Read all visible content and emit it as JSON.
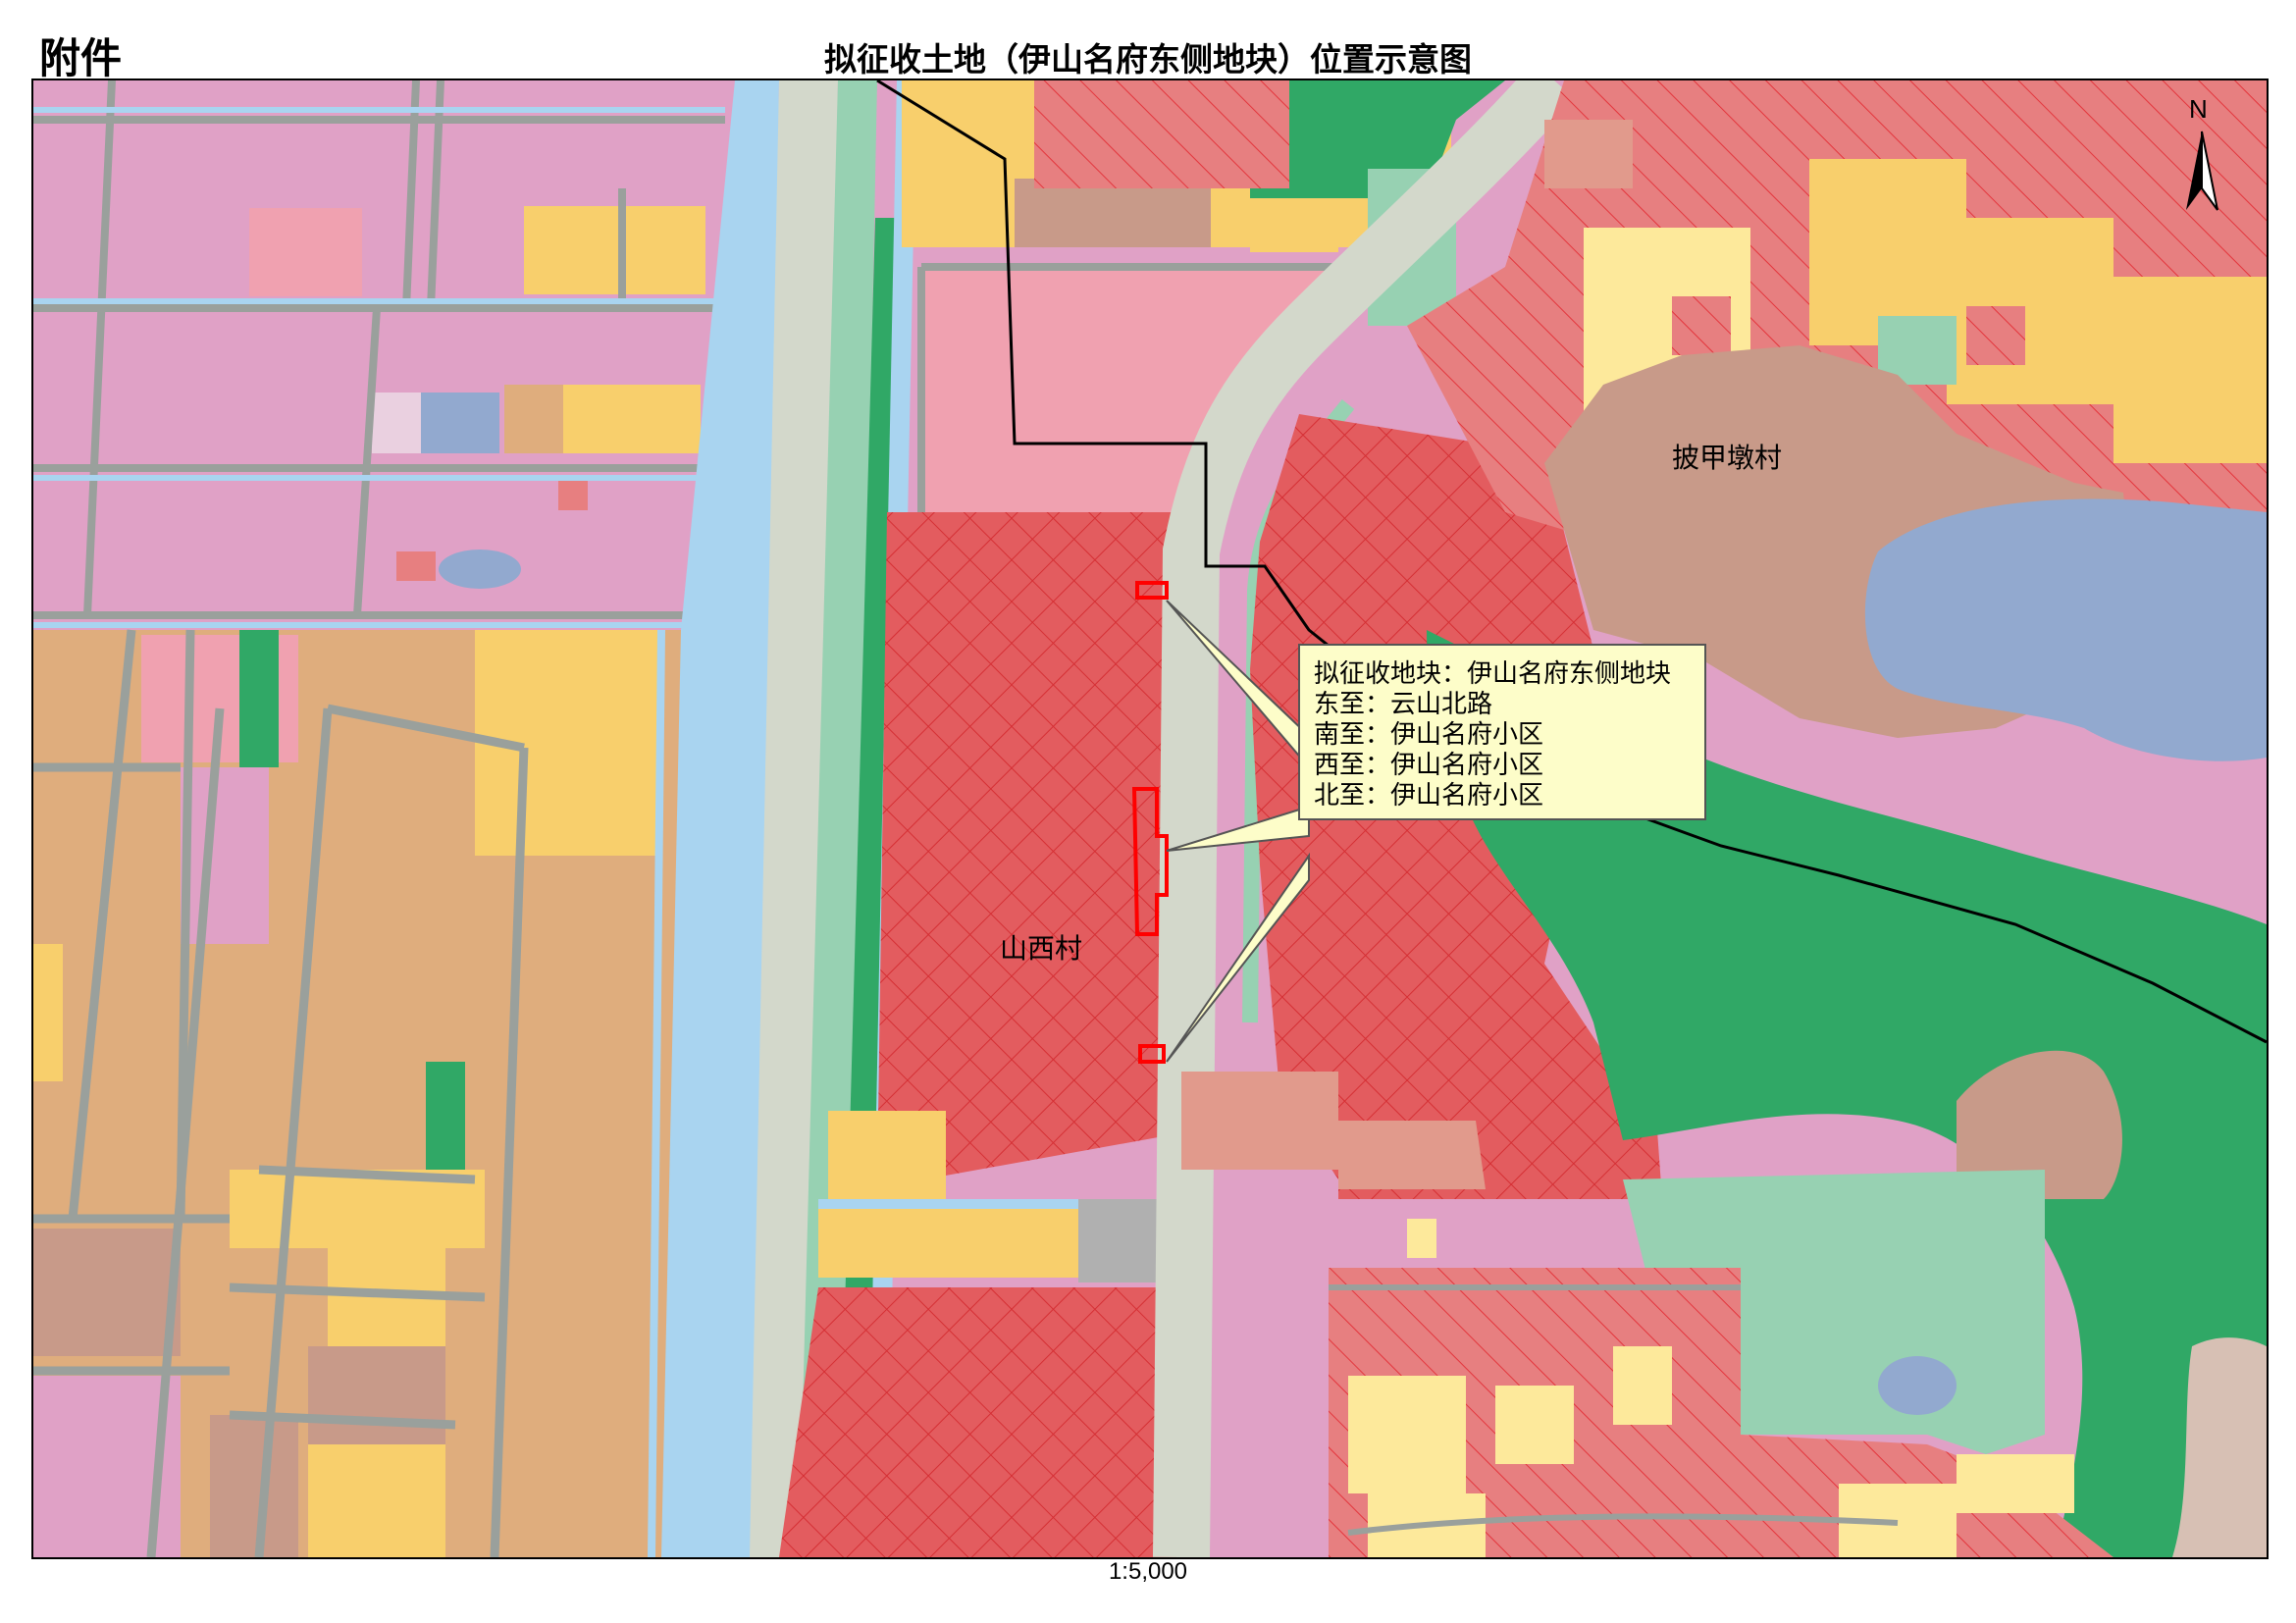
{
  "header": {
    "attachment_label": "附件",
    "title": "拟征收土地（伊山名府东侧地块）位置示意图"
  },
  "map": {
    "north_label": "N",
    "scale": "1:5,000",
    "places": {
      "village_east": "披甲墩村",
      "village_west": "山西村"
    },
    "callout": {
      "line1": "拟征收地块：伊山名府东侧地块",
      "line2": "东至：云山北路",
      "line3": "南至：伊山名府小区",
      "line4": "西至：伊山名府小区",
      "line5": "北至：伊山名府小区"
    },
    "colors": {
      "residential_pink": "#e0a1c6",
      "industrial_tan": "#dfad7d",
      "commercial_yellow": "#f8cf6c",
      "light_yellow": "#fde99b",
      "village_red": "#e77f80",
      "crosshatch_red": "#e35c5f",
      "green_space": "#30a866",
      "light_green": "#97d1b2",
      "water_blue": "#92a9cf",
      "river_blue": "#a9d4f0",
      "road_gray": "#d3d8cb",
      "village_brown": "#c89a89",
      "public_pink": "#f0a1b0",
      "parcel_outline": "#ff0000"
    }
  }
}
